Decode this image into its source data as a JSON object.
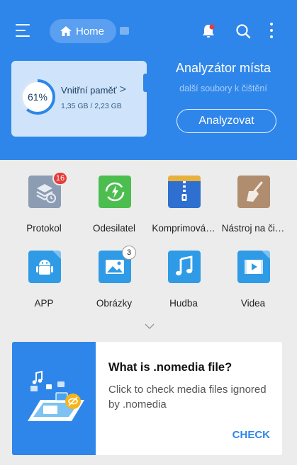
{
  "topbar": {
    "menu_icon": "hamburger-icon",
    "home_label": "Home",
    "icons": [
      "bell-icon",
      "search-icon",
      "more-vertical-icon"
    ]
  },
  "storage": {
    "percent_label": "61%",
    "percent": 61,
    "title": "Vnitřní paměť",
    "chevron": ">",
    "size": "1,35 GB / 2,23 GB"
  },
  "analyzer": {
    "title": "Analyzátor místa",
    "subtitle": "další soubory k čištění",
    "button_label": "Analyzovat"
  },
  "grid": {
    "items": [
      {
        "label": "Protokol",
        "icon": "log-icon",
        "badge": "16"
      },
      {
        "label": "Odesilatel",
        "icon": "sender-icon"
      },
      {
        "label": "Komprimová…",
        "icon": "zip-icon"
      },
      {
        "label": "Nástroj na či…",
        "icon": "broom-icon"
      },
      {
        "label": "APP",
        "icon": "android-icon"
      },
      {
        "label": "Obrázky",
        "icon": "image-icon",
        "badge": "3"
      },
      {
        "label": "Hudba",
        "icon": "music-icon"
      },
      {
        "label": "Videa",
        "icon": "video-icon"
      }
    ],
    "expand_icon": "chevron-down-icon"
  },
  "promo": {
    "title": "What is .nomedia file?",
    "description": "Click to check media files ignored by .nomedia",
    "action": "CHECK"
  },
  "colors": {
    "accent": "#2f86ea",
    "badge_red": "#e83b3b"
  }
}
